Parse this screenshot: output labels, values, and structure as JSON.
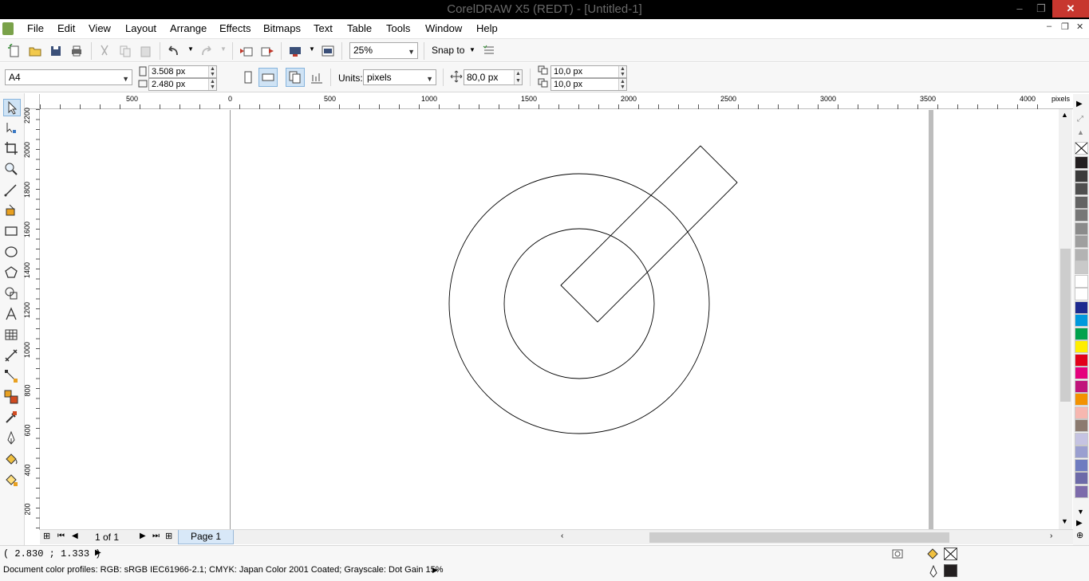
{
  "window": {
    "title": "CorelDRAW X5 (REDT) - [Untitled-1]",
    "minimize": "–",
    "maximize": "❐",
    "close": "✕"
  },
  "menu": {
    "items": [
      "File",
      "Edit",
      "View",
      "Layout",
      "Arrange",
      "Effects",
      "Bitmaps",
      "Text",
      "Table",
      "Tools",
      "Window",
      "Help"
    ],
    "doc_controls": [
      "–",
      "❐",
      "✕"
    ]
  },
  "standard_toolbar": {
    "zoom_value": "25%",
    "snap_to_label": "Snap to"
  },
  "property_bar": {
    "page_size": "A4",
    "width": "3.508 px",
    "height": "2.480 px",
    "units_label": "Units:",
    "units_value": "pixels",
    "nudge": "80,0 px",
    "dup_x": "10,0 px",
    "dup_y": "10,0 px"
  },
  "rulers": {
    "unit": "pixels",
    "h_labels": [
      "500",
      "0",
      "500",
      "1000",
      "1500",
      "2000",
      "2500",
      "3000",
      "3500",
      "4000"
    ],
    "v_labels": [
      "2200",
      "2000",
      "1800",
      "1600",
      "1400",
      "1200",
      "1000",
      "800",
      "600",
      "400",
      "200"
    ]
  },
  "page_nav": {
    "page_count": "1 of 1",
    "page_tab": "Page 1"
  },
  "palette": {
    "colors": [
      "#231f20",
      "#3b3b3b",
      "#4f4f4f",
      "#636363",
      "#777777",
      "#8b8b8b",
      "#9f9f9f",
      "#b3b3b3",
      "#c9c9c9",
      "#ffffff",
      "#ffffff",
      "#1d2a8f",
      "#0099dd",
      "#00a24c",
      "#ffee00",
      "#e2001a",
      "#e5007d",
      "#c0157b",
      "#f39200",
      "#f7b7b0",
      "#8c7b70",
      "#c5c3e2",
      "#9a9fd0",
      "#6f7cc0",
      "#6d6aa8",
      "#7d6bab"
    ]
  },
  "status": {
    "cursor": "( 2.830 ; 1.333 )",
    "color_profiles": "Document color profiles: RGB: sRGB IEC61966-2.1; CMYK: Japan Color 2001 Coated; Grayscale: Dot Gain 15%"
  }
}
